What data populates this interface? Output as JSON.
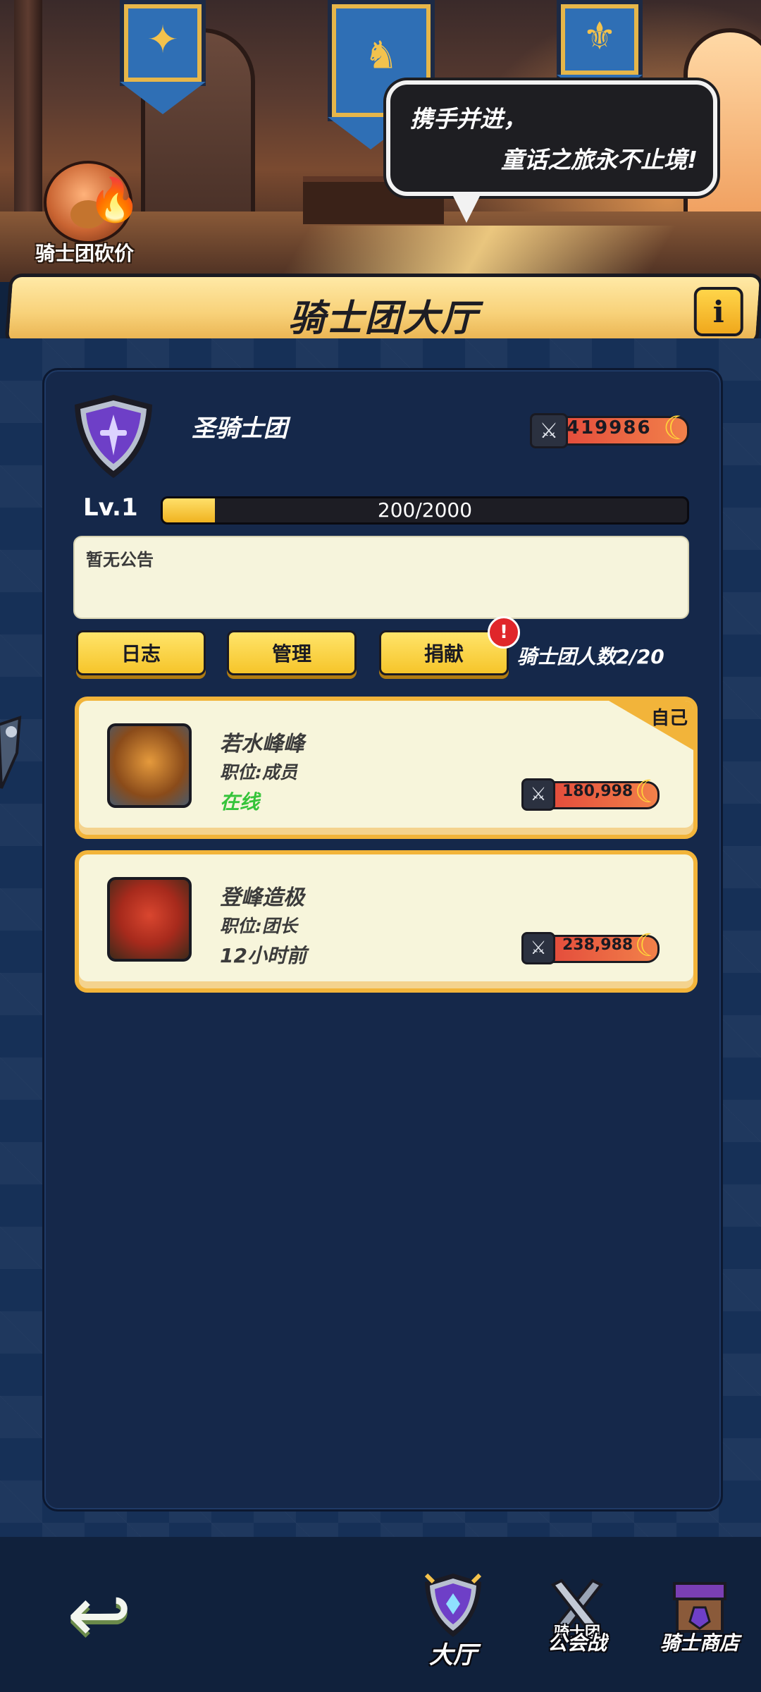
{
  "scene": {
    "speech_line1": "携手并进，",
    "speech_line2": "童话之旅永不止境!",
    "bargain_label": "骑士团砍价"
  },
  "header": {
    "title": "骑士团大厅",
    "info_icon": "info-icon"
  },
  "guild": {
    "name": "圣骑士团",
    "power": "419986",
    "level_label": "Lv.1",
    "exp_text": "200/2000",
    "exp_fraction": 0.1,
    "notice": "暂无公告",
    "member_count": "骑士团人数2/20"
  },
  "actions": {
    "log": "日志",
    "manage": "管理",
    "donate": "捐献",
    "donate_badge": "!"
  },
  "members": [
    {
      "name": "若水峰峰",
      "role": "职位:成员",
      "status": "在线",
      "power": "180,998",
      "tag": "自己"
    },
    {
      "name": "登峰造极",
      "role": "职位:团长",
      "status": "12小时前",
      "power": "238,988"
    }
  ],
  "nav": {
    "hall": "大厅",
    "war_top": "骑士团",
    "war_bottom": "公会战",
    "shop": "骑士商店"
  },
  "colors": {
    "accent_yellow": "#f6c52a",
    "online_green": "#35c43a",
    "card_border": "#f2b43a",
    "panel_bg": "#15284a"
  }
}
